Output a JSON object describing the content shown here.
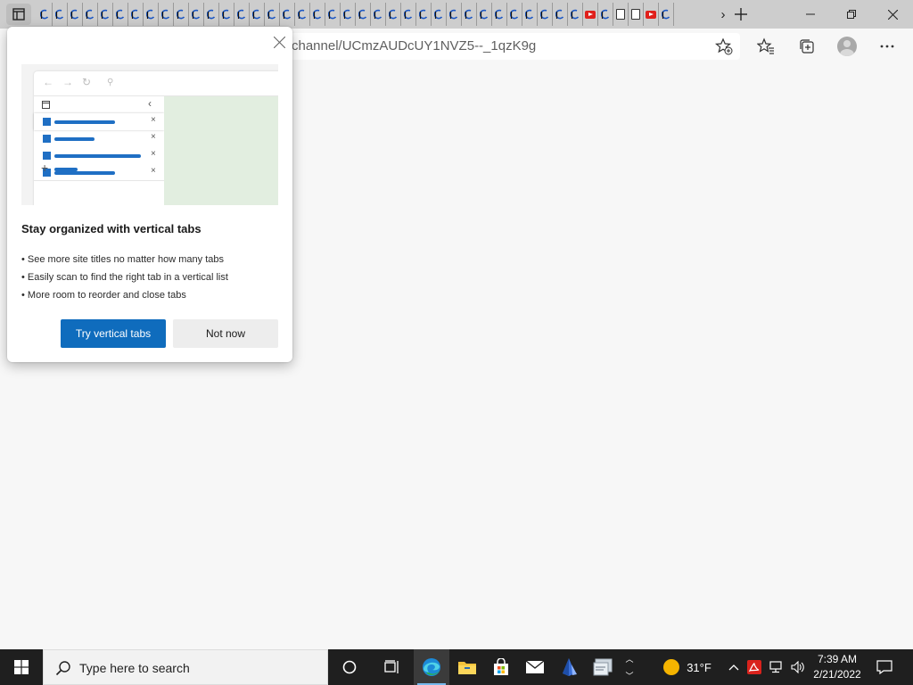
{
  "browser": {
    "url_suffix": "channel/UCmzAUDcUY1NVZ5--_1qzK9g",
    "tab_favicons": [
      "loading",
      "loading",
      "loading",
      "loading",
      "loading",
      "loading",
      "loading",
      "loading",
      "loading",
      "loading",
      "loading",
      "loading",
      "loading",
      "loading",
      "loading",
      "loading",
      "loading",
      "loading",
      "loading",
      "loading",
      "loading",
      "loading",
      "loading",
      "loading",
      "loading",
      "loading",
      "loading",
      "loading",
      "loading",
      "loading",
      "loading",
      "loading",
      "loading",
      "loading",
      "loading",
      "loading",
      "youtube",
      "loading",
      "doc",
      "doc",
      "youtube",
      "loading"
    ]
  },
  "popup": {
    "title": "Stay organized with vertical tabs",
    "bullets": [
      "• See more site titles no matter how many tabs",
      "• Easily scan to find the right tab in a vertical list",
      "• More room to reorder and close tabs"
    ],
    "primary_button": "Try vertical tabs",
    "secondary_button": "Not now"
  },
  "taskbar": {
    "search_placeholder": "Type here to search",
    "weather_temp": "31°F",
    "time": "7:39 AM",
    "date": "2/21/2022"
  },
  "colors": {
    "accent": "#0f6cbd",
    "illustration_blue": "#1f6fc4",
    "illustration_green": "#e2eee0",
    "taskbar": "#1f1f1f"
  }
}
